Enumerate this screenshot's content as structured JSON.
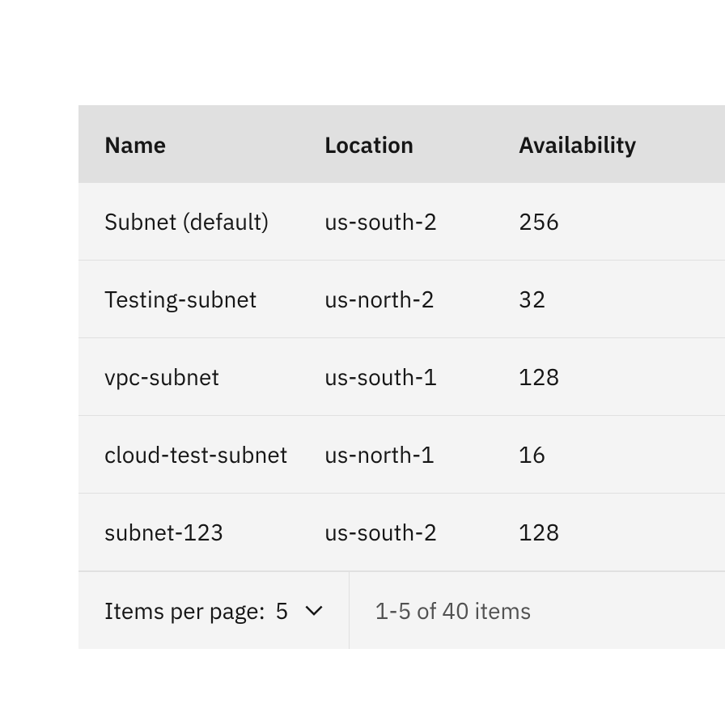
{
  "table": {
    "headers": {
      "name": "Name",
      "location": "Location",
      "availability": "Availability"
    },
    "rows": [
      {
        "name": "Subnet (default)",
        "location": "us-south-2",
        "availability": "256"
      },
      {
        "name": "Testing-subnet",
        "location": "us-north-2",
        "availability": "32"
      },
      {
        "name": "vpc-subnet",
        "location": "us-south-1",
        "availability": "128"
      },
      {
        "name": "cloud-test-subnet",
        "location": "us-north-1",
        "availability": "16"
      },
      {
        "name": "subnet-123",
        "location": "us-south-2",
        "availability": "128"
      }
    ]
  },
  "pagination": {
    "items_per_page_label": "Items per page:",
    "items_per_page_value": "5",
    "range_text": "1-5 of 40 items"
  }
}
